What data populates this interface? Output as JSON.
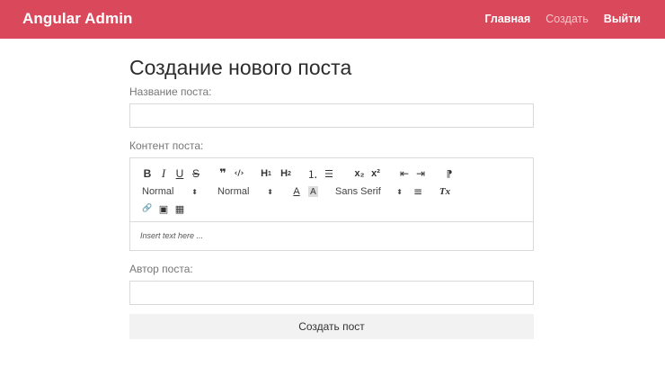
{
  "navbar": {
    "brand": "Angular Admin",
    "links": [
      {
        "label": "Главная"
      },
      {
        "label": "Создать"
      },
      {
        "label": "Выйти"
      }
    ],
    "colors": {
      "background": "#d9495b",
      "active_link": "#f4c6cb"
    }
  },
  "page": {
    "title": "Создание нового поста"
  },
  "form": {
    "title_label": "Название поста:",
    "title_value": "",
    "content_label": "Контент поста:",
    "author_label": "Автор поста:",
    "author_value": "",
    "submit_label": "Создать пост"
  },
  "editor": {
    "placeholder": "Insert text here ...",
    "toolbar": {
      "bold": "B",
      "italic": "I",
      "underline": "U",
      "strike": "S",
      "blockquote": "❞",
      "code": "‹/›",
      "h1": "H",
      "h1_sub": "1",
      "h2": "H",
      "h2_sub": "2",
      "ordered_list": "⒈",
      "bullet_list": "☰",
      "subscript": "x₂",
      "superscript": "x²",
      "outdent": "⇤",
      "indent": "⇥",
      "direction": "⁋",
      "size_picker": "Normal",
      "header_picker": "Normal",
      "picker_arrow": "⬍",
      "text_color": "A",
      "background_color": "A",
      "font_picker": "Sans Serif",
      "align": "≡",
      "clean": "Tx",
      "link": "🔗",
      "image": "▣",
      "video": "▦"
    },
    "icons": [
      "bold-icon",
      "italic-icon",
      "underline-icon",
      "strike-icon",
      "blockquote-icon",
      "code-block-icon",
      "header-1-icon",
      "header-2-icon",
      "ordered-list-icon",
      "bullet-list-icon",
      "subscript-icon",
      "superscript-icon",
      "outdent-icon",
      "indent-icon",
      "rtl-direction-icon",
      "text-color-icon",
      "background-color-icon",
      "align-icon",
      "clean-format-icon",
      "link-icon",
      "image-icon",
      "video-icon"
    ]
  }
}
